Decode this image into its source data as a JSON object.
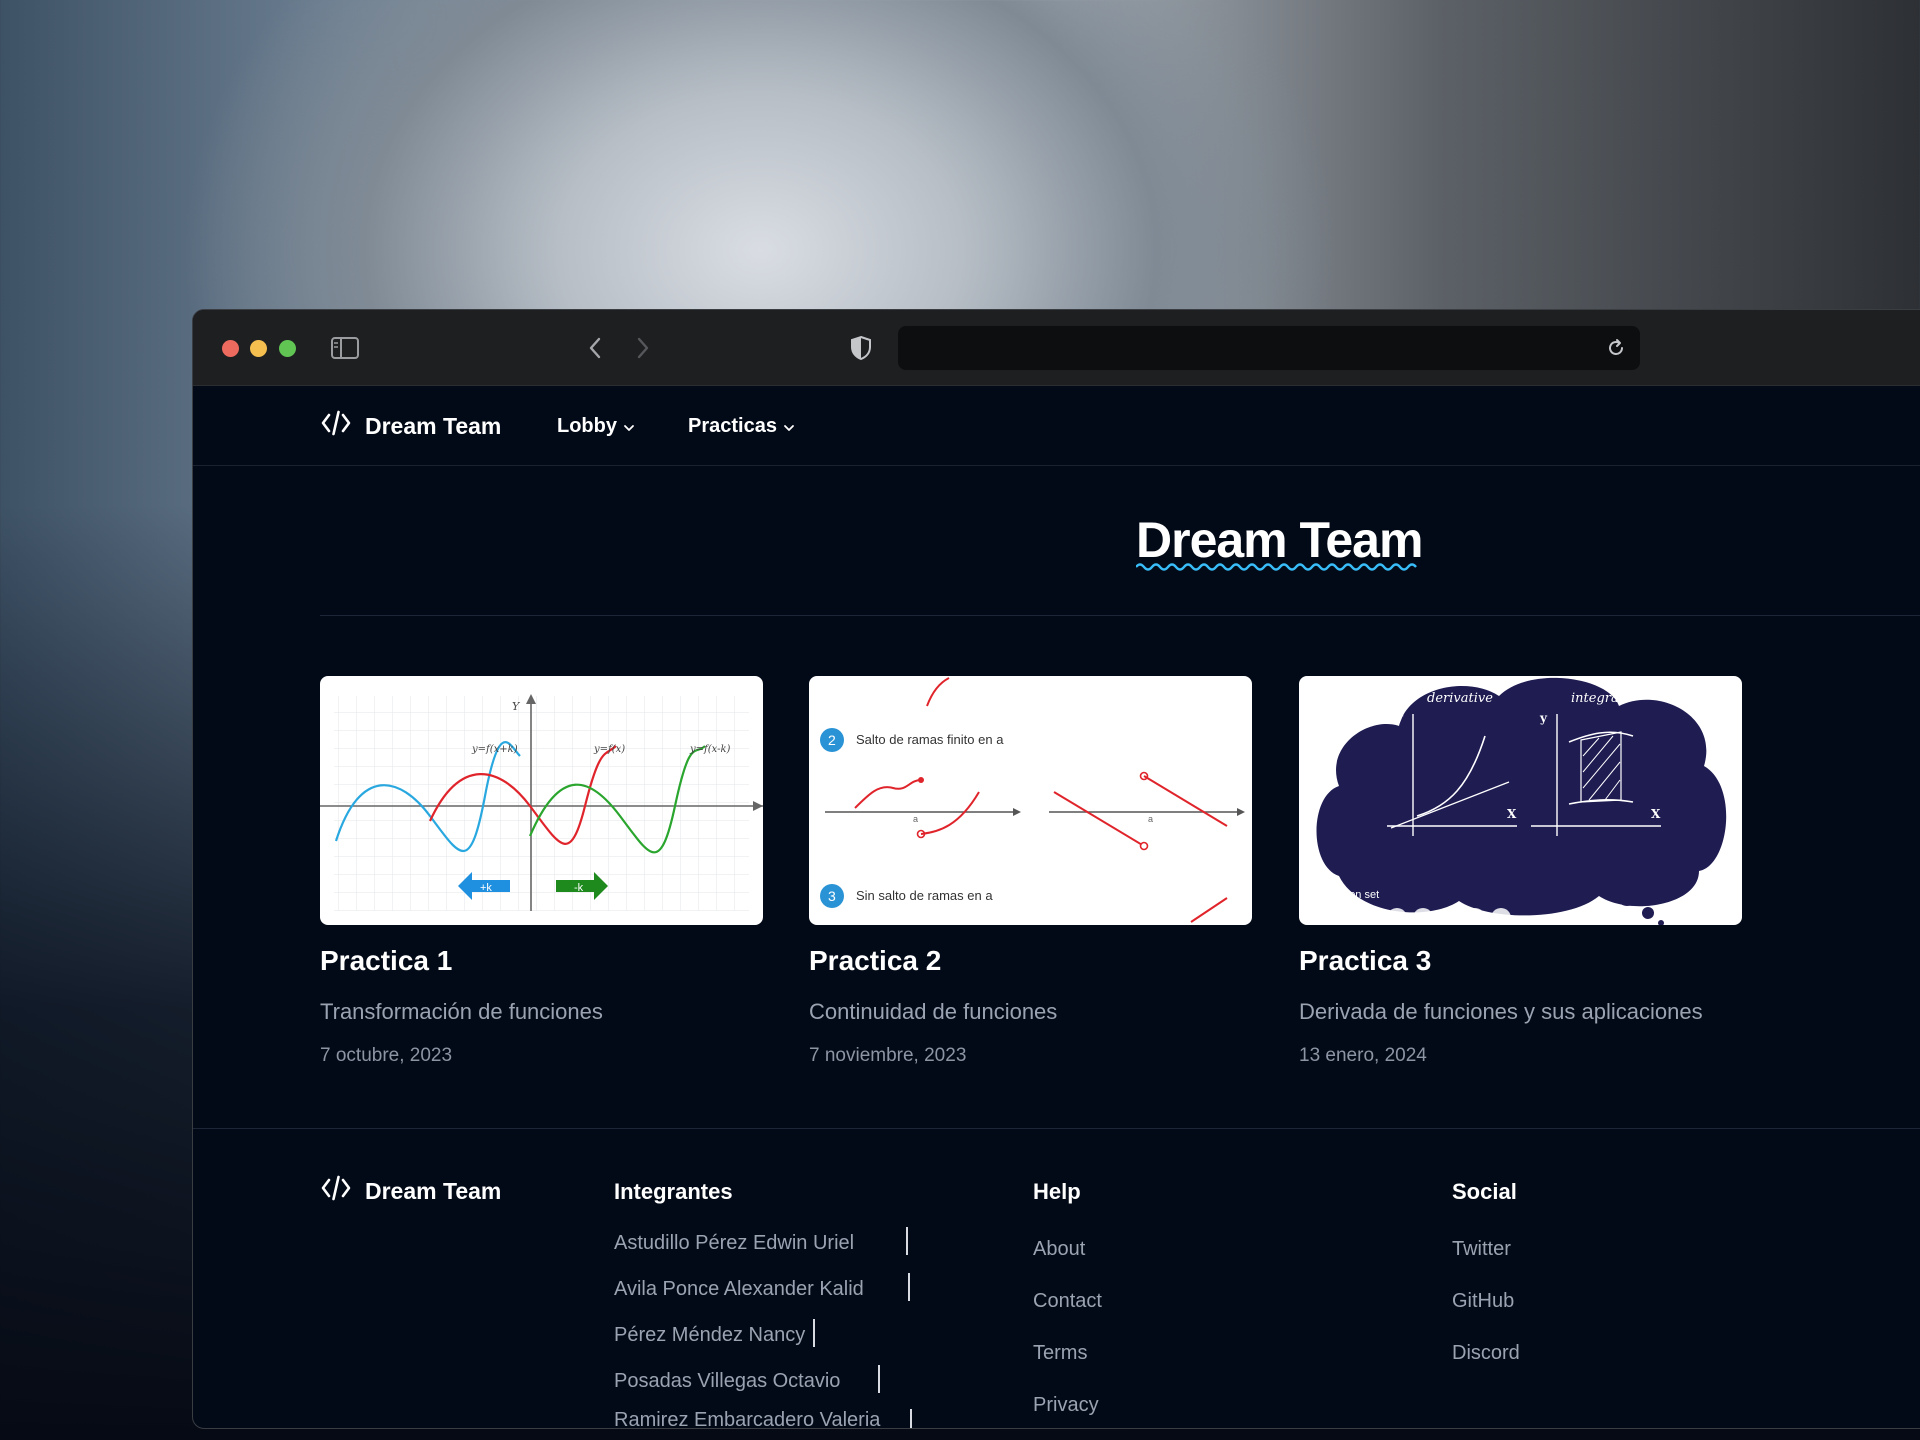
{
  "browser": {
    "url": ""
  },
  "nav": {
    "brand": "Dream Team",
    "items": [
      {
        "label": "Lobby"
      },
      {
        "label": "Practicas"
      }
    ]
  },
  "hero": {
    "title": "Dream Team"
  },
  "cards": [
    {
      "title": "Practica 1",
      "description": "Transformación de funciones",
      "date": "7 octubre, 2023",
      "image": {
        "labels": [
          "Y",
          "y=f(x+k)",
          "y=f(x)",
          "y=f(x-k)",
          "+k",
          "-k"
        ]
      }
    },
    {
      "title": "Practica 2",
      "description": "Continuidad de funciones",
      "date": "7 noviembre, 2023",
      "image": {
        "labels": [
          "2",
          "Salto de ramas finito en a",
          "3",
          "Sin salto de ramas en a",
          "a",
          "a"
        ]
      }
    },
    {
      "title": "Practica 3",
      "description": "Derivada de funciones y sus aplicaciones",
      "date": "13 enero, 2024",
      "image": {
        "labels": [
          "derivative",
          "integral",
          "y",
          "y",
          "X",
          "X",
          "Bonus icon set"
        ]
      }
    }
  ],
  "footer": {
    "brand": "Dream Team",
    "integrantes": {
      "heading": "Integrantes",
      "members": [
        "Astudillo Pérez Edwin Uriel",
        "Avila Ponce Alexander Kalid",
        "Pérez Méndez Nancy",
        "Posadas Villegas Octavio",
        "Ramirez Embarcadero Valeria"
      ]
    },
    "help": {
      "heading": "Help",
      "links": [
        "About",
        "Contact",
        "Terms",
        "Privacy"
      ]
    },
    "social": {
      "heading": "Social",
      "links": [
        "Twitter",
        "GitHub",
        "Discord"
      ]
    }
  },
  "colors": {
    "background": "#030a17",
    "accent": "#38bdf8",
    "text": "#ffffff",
    "muted": "#9aa3b2"
  }
}
